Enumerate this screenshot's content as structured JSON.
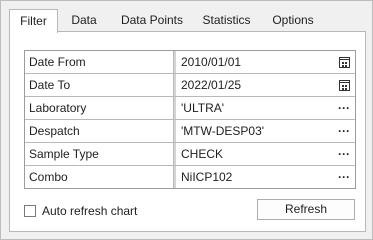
{
  "tabs": [
    {
      "label": "Filter",
      "active": true
    },
    {
      "label": "Data",
      "active": false
    },
    {
      "label": "Data Points",
      "active": false
    },
    {
      "label": "Statistics",
      "active": false
    },
    {
      "label": "Options",
      "active": false
    }
  ],
  "filter": {
    "rows": [
      {
        "label": "Date From",
        "value": "2010/01/01",
        "button_icon": "calendar-icon"
      },
      {
        "label": "Date To",
        "value": "2022/01/25",
        "button_icon": "calendar-icon"
      },
      {
        "label": "Laboratory",
        "value": "'ULTRA'",
        "button_icon": "ellipsis-icon"
      },
      {
        "label": "Despatch",
        "value": "'MTW-DESP03'",
        "button_icon": "ellipsis-icon"
      },
      {
        "label": "Sample Type",
        "value": "CHECK",
        "button_icon": "ellipsis-icon"
      },
      {
        "label": "Combo",
        "value": "NiICP102",
        "button_icon": "ellipsis-icon"
      }
    ],
    "ellipsis_glyph": "···",
    "auto_refresh": {
      "label": "Auto refresh chart",
      "checked": false
    },
    "refresh_label": "Refresh"
  }
}
